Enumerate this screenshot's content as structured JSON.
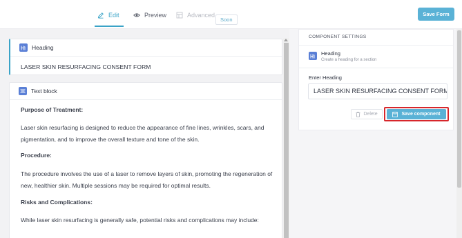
{
  "tabs": {
    "edit": "Edit",
    "preview": "Preview",
    "advanced": "Advanced",
    "soon_badge": "Soon"
  },
  "save_form": "Save Form",
  "blocks": {
    "heading_block": {
      "title": "Heading",
      "value": "LASER SKIN RESURFACING CONSENT FORM"
    },
    "text_block": {
      "title": "Text block",
      "paragraphs": [
        "Purpose of Treatment:",
        "Laser skin resurfacing is designed to reduce the appearance of fine lines, wrinkles, scars, and pigmentation, and to improve the overall texture and tone of the skin.",
        "Procedure:",
        "The procedure involves the use of a laser to remove layers of skin, promoting the regeneration of new, healthier skin. Multiple sessions may be required for optimal results.",
        "Risks and Complications:",
        "While laser skin resurfacing is generally safe, potential risks and complications may include:"
      ]
    }
  },
  "settings": {
    "title": "COMPONENT SETTINGS",
    "component_name": "Heading",
    "component_desc": "Create a heading for a section",
    "enter_label": "Enter Heading",
    "heading_value": "LASER SKIN RESURFACING CONSENT FORM",
    "delete_label": "Delete",
    "save_label": "Save component"
  },
  "colors": {
    "accent": "#3aa3c7",
    "button": "#5ab2d6",
    "highlight": "#d7262b",
    "badge": "#5a7fd6"
  }
}
